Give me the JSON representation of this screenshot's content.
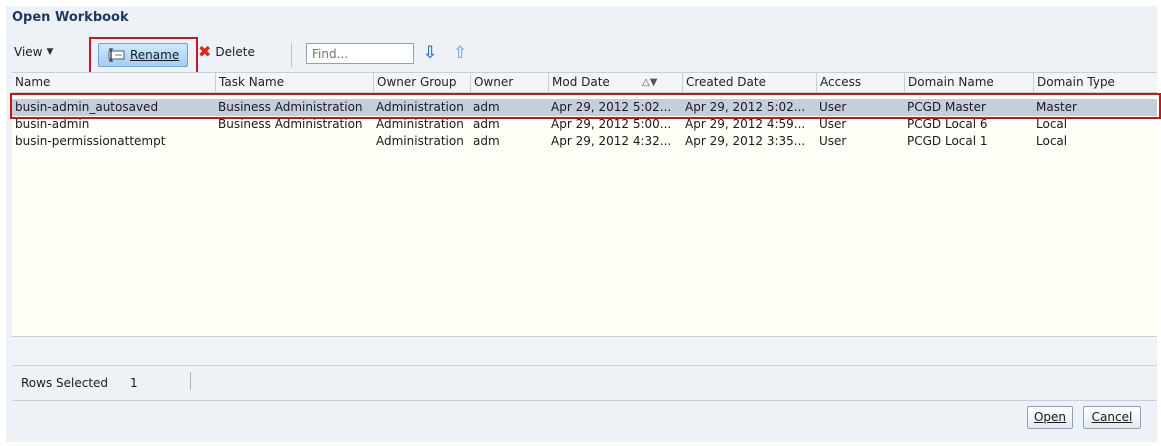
{
  "dialog": {
    "title": "Open Workbook"
  },
  "toolbar": {
    "view_label": "View",
    "rename_label": "Rename",
    "delete_label": "Delete",
    "find_placeholder": "Find...",
    "icons": {
      "rename": "rename-icon",
      "delete": "delete-x-icon",
      "find_next": "arrow-down-icon",
      "find_prev": "arrow-up-icon"
    }
  },
  "table": {
    "columns": [
      "Name",
      "Task Name",
      "Owner Group",
      "Owner",
      "Mod Date",
      "Created Date",
      "Access",
      "Domain Name",
      "Domain Type"
    ],
    "sort_indicator": "△▼",
    "rows": [
      [
        "busin-admin_autosaved",
        "Business Administration",
        "Administration",
        "adm",
        "Apr 29, 2012 5:02...",
        "Apr 29, 2012 5:02...",
        "User",
        "PCGD Master",
        "Master"
      ],
      [
        "busin-admin",
        "Business Administration",
        "Administration",
        "adm",
        "Apr 29, 2012 5:00...",
        "Apr 29, 2012 4:59...",
        "User",
        "PCGD Local 6",
        "Local"
      ],
      [
        "busin-permissionattempt",
        "",
        "Administration",
        "adm",
        "Apr 29, 2012 4:32...",
        "Apr 29, 2012 3:35...",
        "User",
        "PCGD Local 1",
        "Local"
      ]
    ],
    "selected_row": 0
  },
  "status": {
    "rows_selected_label": "Rows Selected",
    "rows_selected_count": "1"
  },
  "buttons": {
    "open_label": "Open",
    "cancel_label": "Cancel"
  },
  "colors": {
    "highlight": "#c0181f",
    "selected_row": "#c5cfdb",
    "title": "#1b3a64"
  }
}
